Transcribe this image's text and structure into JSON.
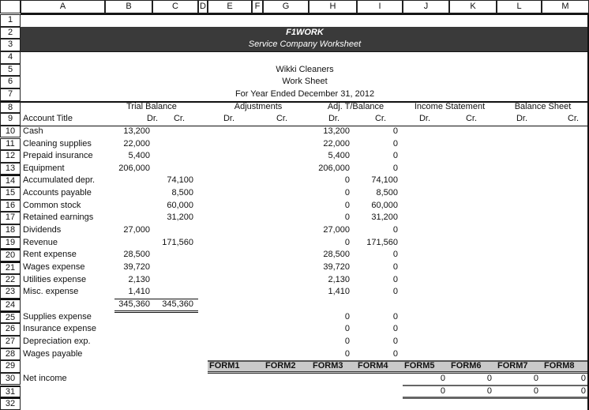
{
  "columns": [
    "A",
    "B",
    "C",
    "D",
    "E",
    "F",
    "G",
    "H",
    "I",
    "J",
    "K",
    "L",
    "M"
  ],
  "row_numbers": [
    "1",
    "2",
    "3",
    "4",
    "5",
    "6",
    "7",
    "8",
    "9",
    "10",
    "11",
    "12",
    "13",
    "14",
    "15",
    "16",
    "17",
    "18",
    "19",
    "20",
    "21",
    "22",
    "23",
    "24",
    "25",
    "26",
    "27",
    "28",
    "29",
    "30",
    "31",
    "32"
  ],
  "banner": {
    "title": "F1WORK",
    "subtitle": "Service Company Worksheet",
    "bg_color": "#3a3a3a"
  },
  "heading": {
    "company": "Wikki Cleaners",
    "doc": "Work Sheet",
    "period": "For Year Ended December 31, 2012"
  },
  "group_headers": {
    "trial_balance": "Trial Balance",
    "adjustments": "Adjustments",
    "adj_tb": "Adj. T/Balance",
    "income_statement": "Income Statement",
    "balance_sheet": "Balance Sheet"
  },
  "sub_headers": {
    "account_title": "Account Title",
    "dr": "Dr.",
    "cr": "Cr."
  },
  "accounts": [
    {
      "row": 10,
      "title": "Cash",
      "tb_dr": "13,200",
      "tb_cr": "",
      "atb_dr": "13,200",
      "atb_cr": "0"
    },
    {
      "row": 11,
      "title": "Cleaning supplies",
      "tb_dr": "22,000",
      "tb_cr": "",
      "atb_dr": "22,000",
      "atb_cr": "0"
    },
    {
      "row": 12,
      "title": "Prepaid insurance",
      "tb_dr": "5,400",
      "tb_cr": "",
      "atb_dr": "5,400",
      "atb_cr": "0"
    },
    {
      "row": 13,
      "title": "Equipment",
      "tb_dr": "206,000",
      "tb_cr": "",
      "atb_dr": "206,000",
      "atb_cr": "0"
    },
    {
      "row": 14,
      "title": "Accumulated depr.",
      "tb_dr": "",
      "tb_cr": "74,100",
      "atb_dr": "0",
      "atb_cr": "74,100"
    },
    {
      "row": 15,
      "title": "Accounts payable",
      "tb_dr": "",
      "tb_cr": "8,500",
      "atb_dr": "0",
      "atb_cr": "8,500"
    },
    {
      "row": 16,
      "title": "Common stock",
      "tb_dr": "",
      "tb_cr": "60,000",
      "atb_dr": "0",
      "atb_cr": "60,000"
    },
    {
      "row": 17,
      "title": "Retained earnings",
      "tb_dr": "",
      "tb_cr": "31,200",
      "atb_dr": "0",
      "atb_cr": "31,200"
    },
    {
      "row": 18,
      "title": "Dividends",
      "tb_dr": "27,000",
      "tb_cr": "",
      "atb_dr": "27,000",
      "atb_cr": "0"
    },
    {
      "row": 19,
      "title": "Revenue",
      "tb_dr": "",
      "tb_cr": "171,560",
      "atb_dr": "0",
      "atb_cr": "171,560"
    },
    {
      "row": 20,
      "title": "Rent expense",
      "tb_dr": "28,500",
      "tb_cr": "",
      "atb_dr": "28,500",
      "atb_cr": "0"
    },
    {
      "row": 21,
      "title": "Wages expense",
      "tb_dr": "39,720",
      "tb_cr": "",
      "atb_dr": "39,720",
      "atb_cr": "0"
    },
    {
      "row": 22,
      "title": "Utilities expense",
      "tb_dr": "2,130",
      "tb_cr": "",
      "atb_dr": "2,130",
      "atb_cr": "0"
    },
    {
      "row": 23,
      "title": "Misc. expense",
      "tb_dr": "1,410",
      "tb_cr": "",
      "atb_dr": "1,410",
      "atb_cr": "0"
    }
  ],
  "totals": {
    "tb_dr": "345,360",
    "tb_cr": "345,360"
  },
  "adjusting_accounts": [
    {
      "row": 25,
      "title": "Supplies expense",
      "atb_dr": "0",
      "atb_cr": "0"
    },
    {
      "row": 26,
      "title": "Insurance expense",
      "atb_dr": "0",
      "atb_cr": "0"
    },
    {
      "row": 27,
      "title": "Depreciation exp.",
      "atb_dr": "0",
      "atb_cr": "0"
    },
    {
      "row": 28,
      "title": "Wages payable",
      "atb_dr": "0",
      "atb_cr": "0"
    }
  ],
  "form_labels": [
    "FORM1",
    "FORM2",
    "FORM3",
    "FORM4",
    "FORM5",
    "FORM6",
    "FORM7",
    "FORM8"
  ],
  "net_income": {
    "title": "Net income",
    "row30": [
      "0",
      "0",
      "0",
      "0"
    ],
    "row31": [
      "0",
      "0",
      "0",
      "0"
    ]
  }
}
